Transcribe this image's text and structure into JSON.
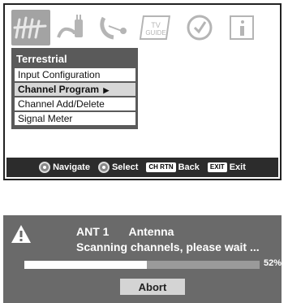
{
  "menu": {
    "icons": [
      {
        "name": "terrestrial-antenna-icon",
        "active": true
      },
      {
        "name": "preferences-plug-icon",
        "active": false
      },
      {
        "name": "satellite-dish-icon",
        "active": false
      },
      {
        "name": "tv-guide-icon",
        "label_line1": "TV",
        "label_line2": "GUIDE",
        "active": false
      },
      {
        "name": "clock-icon",
        "active": false
      },
      {
        "name": "information-icon",
        "active": false
      }
    ],
    "title": "Terrestrial",
    "items": [
      {
        "label": "Input Configuration",
        "selected": false
      },
      {
        "label": "Channel Program",
        "selected": true,
        "arrow": "▶"
      },
      {
        "label": "Channel Add/Delete",
        "selected": false
      },
      {
        "label": "Signal Meter",
        "selected": false
      }
    ]
  },
  "help_bar": {
    "navigate_label": "Navigate",
    "select_label": "Select",
    "back_key": "CH RTN",
    "back_label": "Back",
    "exit_key": "EXIT",
    "exit_label": "Exit"
  },
  "scan": {
    "source_name": "ANT 1",
    "source_type": "Antenna",
    "message": "Scanning channels, please wait ...",
    "progress_percent": 52,
    "progress_label": "52%",
    "abort_label": "Abort"
  },
  "colors": {
    "panel_bg": "#5a5a5a",
    "scan_bg": "#6a6a6a",
    "active_icon_bg": "#a3a3a3"
  }
}
